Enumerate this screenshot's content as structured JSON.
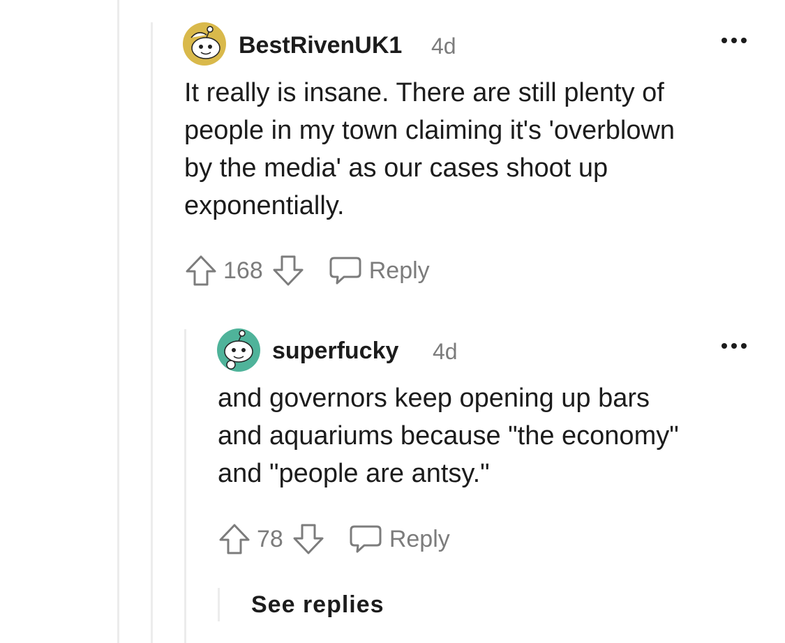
{
  "comments": [
    {
      "username": "BestRivenUK1",
      "age": "4d",
      "body": [
        "It really is insane. There are still plenty of",
        "people in my town claiming it's 'overblown",
        "by the media' as our cases shoot up",
        "exponentially."
      ],
      "votes": "168",
      "reply_label": "Reply",
      "avatar_color": "#d9b94b"
    },
    {
      "username": "superfucky",
      "age": "4d",
      "body": [
        "and governors keep opening up bars",
        "and aquariums because \"the economy\"",
        "and \"people are antsy.\""
      ],
      "votes": "78",
      "reply_label": "Reply",
      "avatar_color": "#4fb39a"
    }
  ],
  "see_replies_label": "See replies",
  "icons": {
    "upvote": "upvote-arrow-icon",
    "downvote": "downvote-arrow-icon",
    "reply": "speech-bubble-icon",
    "more": "ellipsis-icon"
  }
}
